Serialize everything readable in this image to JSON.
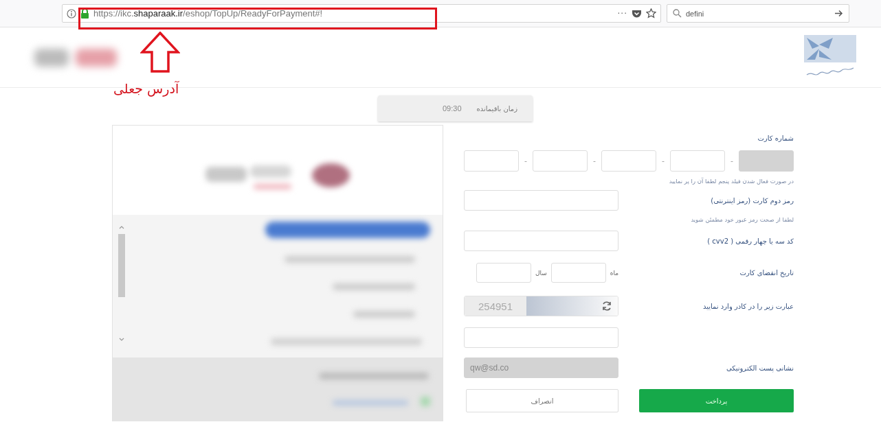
{
  "browser": {
    "url": "https://ikc.**shaparaak.ir**/eshop/TopUp/ReadyForPayment#!",
    "page_actions": "···",
    "search": {
      "value": "defini"
    }
  },
  "annotation": {
    "label": "آدرس جعلی"
  },
  "timer": {
    "label": "زمان باقیمانده",
    "value": "09:30"
  },
  "form": {
    "card_number": {
      "label": "شماره کارت",
      "separator": "-",
      "fields": [
        {
          "disabled": true
        },
        {
          "disabled": false
        },
        {
          "disabled": false
        },
        {
          "disabled": false
        },
        {
          "disabled": false
        }
      ],
      "hint": "در صورت فعال شدن فیلد پنجم لطفا آن را پر نمایید"
    },
    "password": {
      "label": "رمز دوم کارت (رمز اینترنتی)",
      "hint": "لطفا از صحت رمز عبور خود مطمئن شوید"
    },
    "cvv2": {
      "label": "کد سه یا چهار رقمی ( cvv2 )"
    },
    "expiry": {
      "label": "تاریخ انقضای کارت",
      "month_label": "ماه",
      "year_label": "سال"
    },
    "captcha": {
      "label": "عبارت زیر را در کادر وارد نمایید",
      "code": "254951"
    },
    "email": {
      "label": "نشانی پست الکترونیکی",
      "value": "qw@sd.co",
      "disabled": true
    },
    "buttons": [
      {
        "kind": "primary",
        "label": "پرداخت"
      },
      {
        "kind": "secondary",
        "label": "انصراف"
      }
    ]
  }
}
